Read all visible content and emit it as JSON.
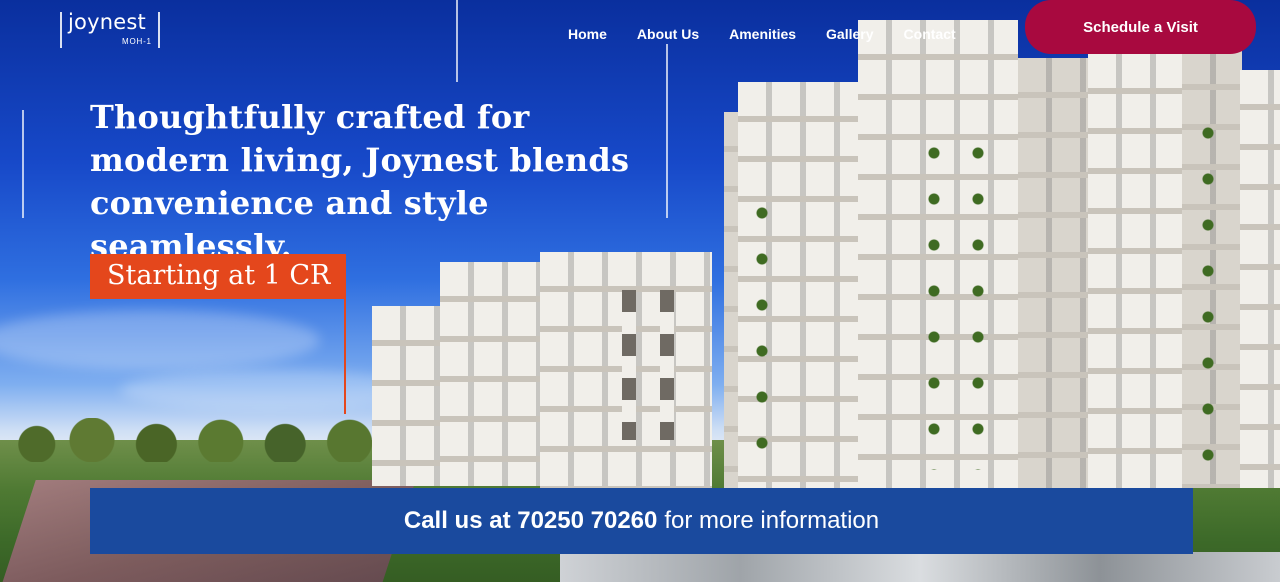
{
  "brand": {
    "name": "joynest",
    "sub": "MOH-1"
  },
  "nav": {
    "items": [
      {
        "label": "Home"
      },
      {
        "label": "About Us"
      },
      {
        "label": "Amenities"
      },
      {
        "label": "Gallery"
      },
      {
        "label": "Contact"
      }
    ],
    "cta_label": "Schedule a Visit"
  },
  "hero": {
    "headline": "Thoughtfully crafted for modern living, Joynest blends convenience and style seamlessly.",
    "price_label": "Starting at 1 CR"
  },
  "call_bar": {
    "bold_text": "Call us at 70250 70260",
    "rest_text": "for more information"
  },
  "colors": {
    "cta": "#a8093f",
    "price_tag": "#e4471c",
    "call_bar": "#1a4a9e"
  }
}
